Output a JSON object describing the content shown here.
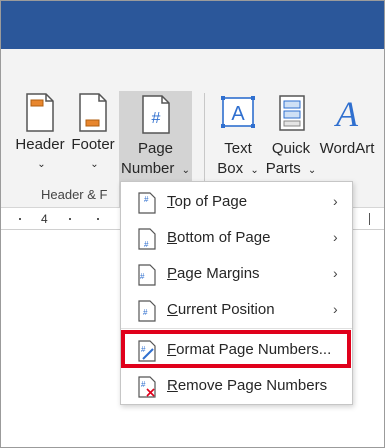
{
  "ribbon": {
    "buttons": [
      {
        "line1": "Header",
        "line2": "",
        "chevron": "⌄",
        "icon": "header-page-icon"
      },
      {
        "line1": "Footer",
        "line2": "",
        "chevron": "⌄",
        "icon": "footer-page-icon"
      },
      {
        "line1": "Page",
        "line2": "Number",
        "chevron": "⌄",
        "icon": "page-number-icon"
      },
      {
        "line1": "Text",
        "line2": "Box",
        "chevron": "⌄",
        "icon": "text-box-icon"
      },
      {
        "line1": "Quick",
        "line2": "Parts",
        "chevron": "⌄",
        "icon": "quick-parts-icon"
      },
      {
        "line1": "WordArt",
        "line2": "",
        "chevron": "",
        "icon": "wordart-icon"
      }
    ],
    "group_label": "Header & F",
    "textbox_glyph": "A",
    "wordart_glyph": "A",
    "pagenum_glyph": "#"
  },
  "ruler": {
    "number": "4"
  },
  "menu": {
    "items": [
      {
        "prefix": "",
        "accel": "T",
        "rest": "op of Page",
        "submenu": true,
        "icon": "page-top-icon"
      },
      {
        "prefix": "",
        "accel": "B",
        "rest": "ottom of Page",
        "submenu": true,
        "icon": "page-bottom-icon"
      },
      {
        "prefix": "",
        "accel": "P",
        "rest": "age Margins",
        "submenu": true,
        "icon": "page-margins-icon"
      },
      {
        "prefix": "",
        "accel": "C",
        "rest": "urrent Position",
        "submenu": true,
        "icon": "current-position-icon"
      },
      {
        "prefix": "",
        "accel": "F",
        "rest": "ormat Page Numbers...",
        "submenu": false,
        "icon": "format-page-numbers-icon"
      },
      {
        "prefix": "",
        "accel": "R",
        "rest": "emove Page Numbers",
        "submenu": false,
        "icon": "remove-page-numbers-icon"
      }
    ],
    "submenu_arrow": "›"
  },
  "colors": {
    "title_bar": "#2b579a",
    "accent_orange": "#e8862d",
    "accent_blue": "#2f6fcf",
    "highlight": "#e0001b"
  }
}
